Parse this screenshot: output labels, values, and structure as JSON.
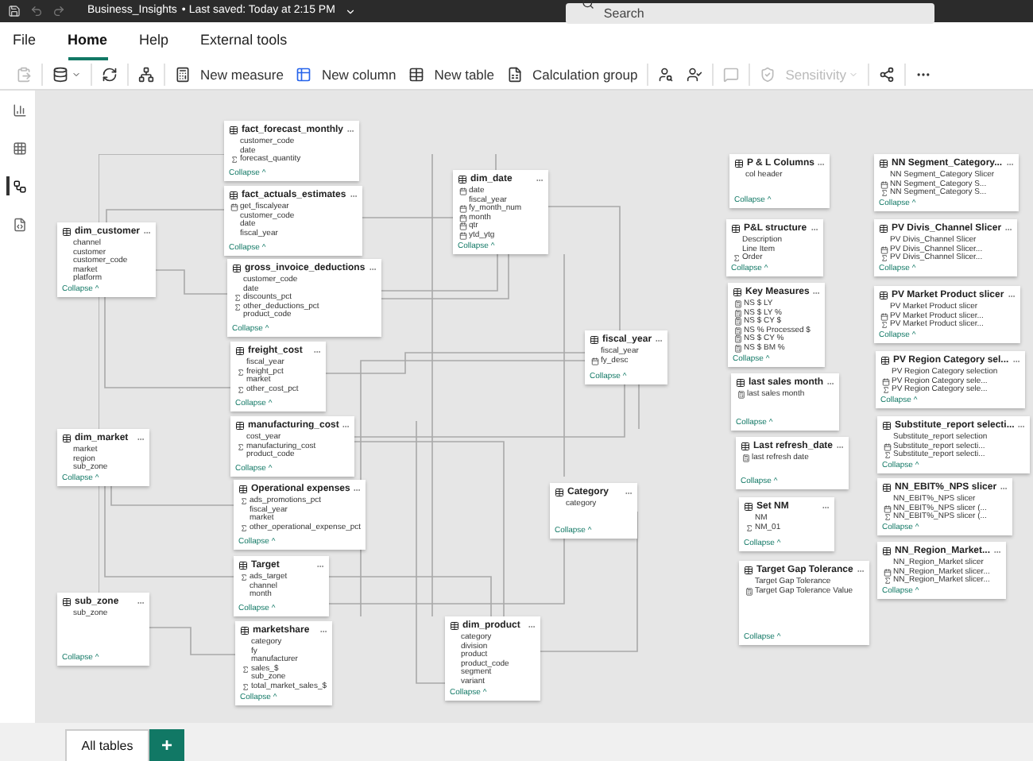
{
  "title_bar": {
    "file_name": "Business_Insights",
    "saved": "• Last saved: Today at 2:15 PM",
    "search_placeholder": "Search"
  },
  "menu_tabs": [
    {
      "label": "File",
      "selected": false
    },
    {
      "label": "Home",
      "selected": true
    },
    {
      "label": "Help",
      "selected": false
    },
    {
      "label": "External tools",
      "selected": false
    }
  ],
  "ribbon": [
    {
      "kind": "paste",
      "disabled": true
    },
    {
      "kind": "data",
      "disabled": false
    },
    {
      "kind": "refresh",
      "disabled": false
    },
    {
      "kind": "relationships",
      "disabled": false
    },
    {
      "kind": "measure",
      "label": "New measure",
      "disabled": false
    },
    {
      "kind": "column",
      "label": "New column",
      "disabled": false
    },
    {
      "kind": "table",
      "label": "New table",
      "disabled": false
    },
    {
      "kind": "calc_group",
      "label": "Calculation group",
      "disabled": false
    },
    {
      "kind": "roles",
      "disabled": false
    },
    {
      "kind": "view_as",
      "disabled": false
    },
    {
      "kind": "comment",
      "disabled": true
    },
    {
      "kind": "sensitivity",
      "label": "Sensitivity",
      "disabled": true
    },
    {
      "kind": "publish",
      "disabled": false
    },
    {
      "kind": "more",
      "disabled": false
    }
  ],
  "side_rail": [
    {
      "kind": "report",
      "selected": false
    },
    {
      "kind": "table",
      "selected": false
    },
    {
      "kind": "model",
      "selected": true
    },
    {
      "kind": "dax",
      "selected": false
    }
  ],
  "tables": [
    {
      "title": "fact_forecast_monthly",
      "fields": [
        {
          "name": "customer_code",
          "kind": "column"
        },
        {
          "name": "date",
          "kind": "column"
        },
        {
          "name": "forecast_quantity",
          "kind": "sum"
        }
      ],
      "collapse": "Collapse ^"
    },
    {
      "title": "fact_actuals_estimates",
      "fields": [
        {
          "name": "get_fiscalyear",
          "kind": "calc"
        },
        {
          "name": "customer_code",
          "kind": "column"
        },
        {
          "name": "date",
          "kind": "column"
        },
        {
          "name": "fiscal_year",
          "kind": "column"
        }
      ],
      "collapse": "Collapse ^"
    },
    {
      "title": "gross_invoice_deductions",
      "fields": [
        {
          "name": "customer_code",
          "kind": "column"
        },
        {
          "name": "date",
          "kind": "column"
        },
        {
          "name": "discounts_pct",
          "kind": "sum"
        },
        {
          "name": "other_deductions_pct",
          "kind": "sum"
        },
        {
          "name": "product_code",
          "kind": "column"
        }
      ],
      "collapse": "Collapse ^"
    },
    {
      "title": "freight_cost",
      "fields": [
        {
          "name": "fiscal_year",
          "kind": "column"
        },
        {
          "name": "freight_pct",
          "kind": "sum"
        },
        {
          "name": "market",
          "kind": "column"
        },
        {
          "name": "other_cost_pct",
          "kind": "sum"
        }
      ],
      "collapse": "Collapse ^"
    },
    {
      "title": "manufacturing_cost",
      "fields": [
        {
          "name": "cost_year",
          "kind": "column"
        },
        {
          "name": "manufacturing_cost",
          "kind": "sum"
        },
        {
          "name": "product_code",
          "kind": "column"
        }
      ],
      "collapse": "Collapse ^"
    },
    {
      "title": "Operational expenses",
      "fields": [
        {
          "name": "ads_promotions_pct",
          "kind": "sum"
        },
        {
          "name": "fiscal_year",
          "kind": "column"
        },
        {
          "name": "market",
          "kind": "column"
        },
        {
          "name": "other_operational_expense_pct",
          "kind": "sum"
        }
      ],
      "collapse": "Collapse ^"
    },
    {
      "title": "Target",
      "fields": [
        {
          "name": "ads_target",
          "kind": "sum"
        },
        {
          "name": "channel",
          "kind": "column"
        },
        {
          "name": "month",
          "kind": "column"
        }
      ],
      "collapse": "Collapse ^"
    },
    {
      "title": "marketshare",
      "fields": [
        {
          "name": "category",
          "kind": "column"
        },
        {
          "name": "fy",
          "kind": "column"
        },
        {
          "name": "manufacturer",
          "kind": "column"
        },
        {
          "name": "sales_$",
          "kind": "sum"
        },
        {
          "name": "sub_zone",
          "kind": "column"
        },
        {
          "name": "total_market_sales_$",
          "kind": "sum"
        }
      ],
      "collapse": "Collapse ^"
    },
    {
      "title": "dim_customer",
      "fields": [
        {
          "name": "channel",
          "kind": "column"
        },
        {
          "name": "customer",
          "kind": "column"
        },
        {
          "name": "customer_code",
          "kind": "column"
        },
        {
          "name": "market",
          "kind": "column"
        },
        {
          "name": "platform",
          "kind": "column"
        }
      ],
      "collapse": "Collapse ^"
    },
    {
      "title": "dim_market",
      "fields": [
        {
          "name": "market",
          "kind": "column"
        },
        {
          "name": "region",
          "kind": "column"
        },
        {
          "name": "sub_zone",
          "kind": "column"
        }
      ],
      "collapse": "Collapse ^"
    },
    {
      "title": "sub_zone",
      "fields": [
        {
          "name": "sub_zone",
          "kind": "column"
        }
      ],
      "collapse": "Collapse ^"
    },
    {
      "title": "dim_date",
      "fields": [
        {
          "name": "date",
          "kind": "calc"
        },
        {
          "name": "fiscal_year",
          "kind": "column"
        },
        {
          "name": "fy_month_num",
          "kind": "calc"
        },
        {
          "name": "month",
          "kind": "calc"
        },
        {
          "name": "qtr",
          "kind": "calc"
        },
        {
          "name": "ytd_ytg",
          "kind": "calc"
        }
      ],
      "collapse": "Collapse ^"
    },
    {
      "title": "fiscal_year",
      "fields": [
        {
          "name": "fiscal_year",
          "kind": "column"
        },
        {
          "name": "fy_desc",
          "kind": "calc"
        }
      ],
      "collapse": "Collapse ^"
    },
    {
      "title": "Category",
      "fields": [
        {
          "name": "category",
          "kind": "column"
        }
      ],
      "collapse": "Collapse ^"
    },
    {
      "title": "dim_product",
      "fields": [
        {
          "name": "category",
          "kind": "column"
        },
        {
          "name": "division",
          "kind": "column"
        },
        {
          "name": "product",
          "kind": "column"
        },
        {
          "name": "product_code",
          "kind": "column"
        },
        {
          "name": "segment",
          "kind": "column"
        },
        {
          "name": "variant",
          "kind": "column"
        }
      ],
      "collapse": "Collapse ^"
    },
    {
      "title": "P & L Columns",
      "fields": [
        {
          "name": "col header",
          "kind": "column"
        }
      ],
      "collapse": "Collapse ^"
    },
    {
      "title": "P&L structure",
      "fields": [
        {
          "name": "Description",
          "kind": "column"
        },
        {
          "name": "Line Item",
          "kind": "column"
        },
        {
          "name": "Order",
          "kind": "sum"
        }
      ],
      "collapse": "Collapse ^"
    },
    {
      "title": "Key Measures",
      "fields": [
        {
          "name": "NS $ LY",
          "kind": "measure"
        },
        {
          "name": "NS $ LY %",
          "kind": "measure"
        },
        {
          "name": "NS $ CY $",
          "kind": "measure"
        },
        {
          "name": "NS % Processed $",
          "kind": "measure"
        },
        {
          "name": "NS $ CY %",
          "kind": "measure"
        },
        {
          "name": "NS $ BM %",
          "kind": "measure"
        }
      ],
      "collapse": "Collapse ^"
    },
    {
      "title": "last sales month",
      "fields": [
        {
          "name": "last sales month",
          "kind": "measure"
        }
      ],
      "collapse": "Collapse ^"
    },
    {
      "title": "Last refresh_date",
      "fields": [
        {
          "name": "last refresh date",
          "kind": "measure"
        }
      ],
      "collapse": "Collapse ^"
    },
    {
      "title": "Set NM",
      "fields": [
        {
          "name": "NM",
          "kind": "column"
        },
        {
          "name": "NM_01",
          "kind": "sum"
        }
      ],
      "collapse": "Collapse ^"
    },
    {
      "title": "Target Gap Tolerance",
      "fields": [
        {
          "name": "Target Gap Tolerance",
          "kind": "column"
        },
        {
          "name": "Target Gap Tolerance Value",
          "kind": "measure"
        }
      ],
      "collapse": "Collapse ^"
    },
    {
      "title": "NN Segment_Category...",
      "fields": [
        {
          "name": "NN Segment_Category Slicer",
          "kind": "column"
        },
        {
          "name": "NN Segment_Category S...",
          "kind": "calc"
        },
        {
          "name": "NN Segment_Category S...",
          "kind": "sum"
        }
      ],
      "collapse": "Collapse ^"
    },
    {
      "title": "PV Divis_Channel Slicer",
      "fields": [
        {
          "name": "PV Divis_Channel Slicer",
          "kind": "column"
        },
        {
          "name": "PV Divis_Channel Slicer...",
          "kind": "calc"
        },
        {
          "name": "PV Divis_Channel Slicer...",
          "kind": "sum"
        }
      ],
      "collapse": "Collapse ^"
    },
    {
      "title": "PV Market Product slicer",
      "fields": [
        {
          "name": "PV Market Product slicer",
          "kind": "column"
        },
        {
          "name": "PV Market Product slicer...",
          "kind": "calc"
        },
        {
          "name": "PV Market Product slicer...",
          "kind": "sum"
        }
      ],
      "collapse": "Collapse ^"
    },
    {
      "title": "PV Region Category sel...",
      "fields": [
        {
          "name": "PV Region Category selection",
          "kind": "column"
        },
        {
          "name": "PV Region Category sele...",
          "kind": "calc"
        },
        {
          "name": "PV Region Category sele...",
          "kind": "sum"
        }
      ],
      "collapse": "Collapse ^"
    },
    {
      "title": "Substitute_report selecti...",
      "fields": [
        {
          "name": "Substitute_report selection",
          "kind": "column"
        },
        {
          "name": "Substitute_report selecti...",
          "kind": "calc"
        },
        {
          "name": "Substitute_report selecti...",
          "kind": "sum"
        }
      ],
      "collapse": "Collapse ^"
    },
    {
      "title": "NN_EBIT%_NPS slicer",
      "fields": [
        {
          "name": "NN_EBIT%_NPS slicer",
          "kind": "column"
        },
        {
          "name": "NN_EBIT%_NPS slicer (...",
          "kind": "calc"
        },
        {
          "name": "NN_EBIT%_NPS slicer (...",
          "kind": "sum"
        }
      ],
      "collapse": "Collapse ^"
    },
    {
      "title": "NN_Region_Market...",
      "fields": [
        {
          "name": "NN_Region_Market slicer",
          "kind": "column"
        },
        {
          "name": "NN_Region_Market slicer...",
          "kind": "calc"
        },
        {
          "name": "NN_Region_Market slicer...",
          "kind": "sum"
        }
      ],
      "collapse": "Collapse ^"
    }
  ],
  "bottom_tabs": [
    {
      "label": "All tables",
      "selected": true
    }
  ],
  "add_tab": "+"
}
